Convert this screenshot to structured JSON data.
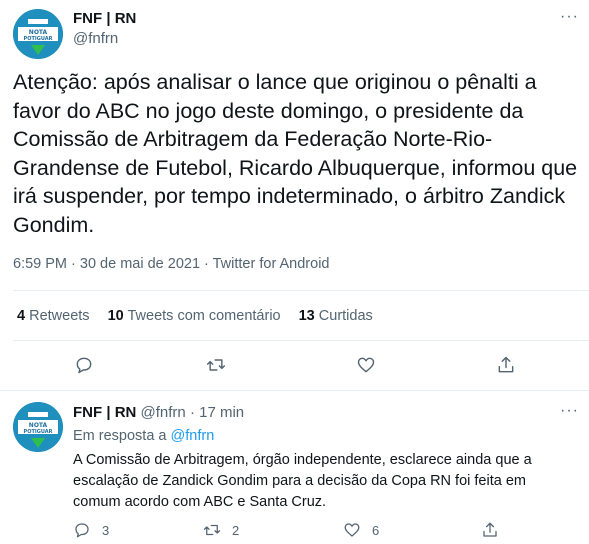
{
  "tweet": {
    "author_name": "FNF | RN",
    "author_handle": "@fnfrn",
    "avatar_text_line1": "NOTA",
    "avatar_text_line2": "POTIGUAR",
    "text": "Atenção: após analisar o lance que originou o pênalti a favor do ABC no jogo deste domingo, o presidente da Comissão de Arbitragem da Federação Norte-Rio-Grandense de Futebol, Ricardo Albuquerque, informou que irá suspender, por tempo indeterminado, o árbitro Zandick Gondim.",
    "timestamp": "6:59 PM · 30 de mai de 2021 · Twitter for Android",
    "stats": {
      "retweets_count": "4",
      "retweets_label": "Retweets",
      "quotes_count": "10",
      "quotes_label": "Tweets com comentário",
      "likes_count": "13",
      "likes_label": "Curtidas"
    }
  },
  "reply": {
    "author_name": "FNF | RN",
    "author_handle": "@fnfrn",
    "time": "· 17 min",
    "replying_prefix": "Em resposta a",
    "replying_to": "@fnfrn",
    "text": "A Comissão de Arbitragem, órgão independente, esclarece ainda que a escalação de Zandick Gondim para a decisão da Copa RN foi feita em comum acordo com ABC e Santa Cruz.",
    "reply_count": "3",
    "retweet_count": "2",
    "like_count": "6"
  },
  "icons": [
    "reply-icon",
    "retweet-icon",
    "like-icon",
    "share-icon",
    "more-icon"
  ],
  "colors": {
    "link": "#1d9bf0",
    "muted": "#536471",
    "avatar": "#1f8fbe"
  }
}
